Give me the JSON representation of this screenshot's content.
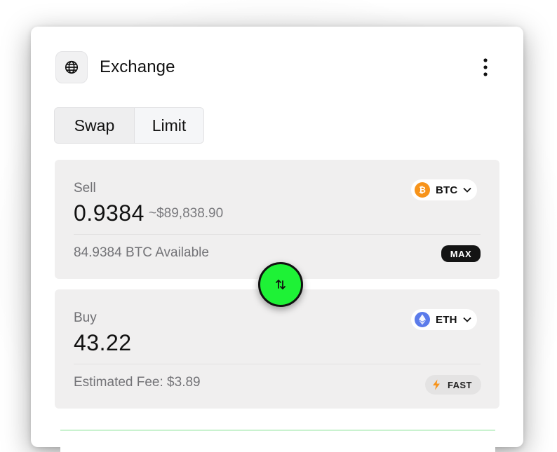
{
  "header": {
    "title": "Exchange",
    "globe_icon": "globe-icon",
    "menu_icon": "kebab-menu-icon"
  },
  "tabs": [
    {
      "label": "Swap",
      "active": true
    },
    {
      "label": "Limit",
      "active": false
    }
  ],
  "sell": {
    "label": "Sell",
    "amount": "0.9384",
    "usd_value": "~$89,838.90",
    "token": {
      "symbol": "BTC",
      "icon": "bitcoin-icon",
      "color": "#f7931a"
    },
    "available": "84.9384 BTC Available",
    "max_label": "MAX"
  },
  "swap_button": {
    "icon": "swap-arrows-icon",
    "color": "#1ef236"
  },
  "buy": {
    "label": "Buy",
    "amount": "43.22",
    "token": {
      "symbol": "ETH",
      "icon": "ethereum-icon",
      "color": "#5b7bea"
    },
    "fee": "Estimated Fee: $3.89",
    "speed_label": "FAST",
    "speed_icon": "lightning-icon",
    "speed_color": "#f7931a"
  }
}
